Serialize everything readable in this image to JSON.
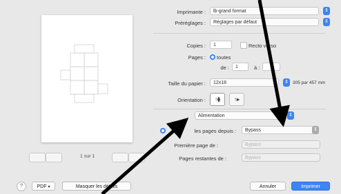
{
  "printer": {
    "label": "Imprimante :",
    "value": "lb-grand format"
  },
  "presets": {
    "label": "Préréglages :",
    "value": "Réglages par défaut"
  },
  "copies": {
    "label": "Copies :",
    "value": "1",
    "recto_verso": "Recto verso"
  },
  "pages": {
    "label": "Pages :",
    "option": "toutes",
    "from_label": "de :",
    "from_value": "1",
    "to_label": "à :"
  },
  "paper": {
    "label": "Taille du papier :",
    "value": "12x18",
    "dimensions": "305 par 457 mm"
  },
  "orientation": {
    "label": "Orientation :",
    "portrait_glyph": "↑⧫",
    "landscape_glyph": "↑▸"
  },
  "section": {
    "value": "Alimentation"
  },
  "feed": {
    "all_pages_label": "les pages depuis :",
    "all_pages_value": "Bypass",
    "first_page_label": "Première page de :",
    "first_page_value": "Bypass",
    "remaining_label": "Pages restantes de :",
    "remaining_value": "Bypass"
  },
  "pager": {
    "count": "1 sur 1"
  },
  "footer": {
    "help": "?",
    "pdf": "PDF",
    "hide_details": "Masquer les détails",
    "cancel": "Annuler",
    "print": "Imprimer"
  },
  "colors": {
    "accent": "#3d84f5",
    "arrow": "#000000"
  }
}
